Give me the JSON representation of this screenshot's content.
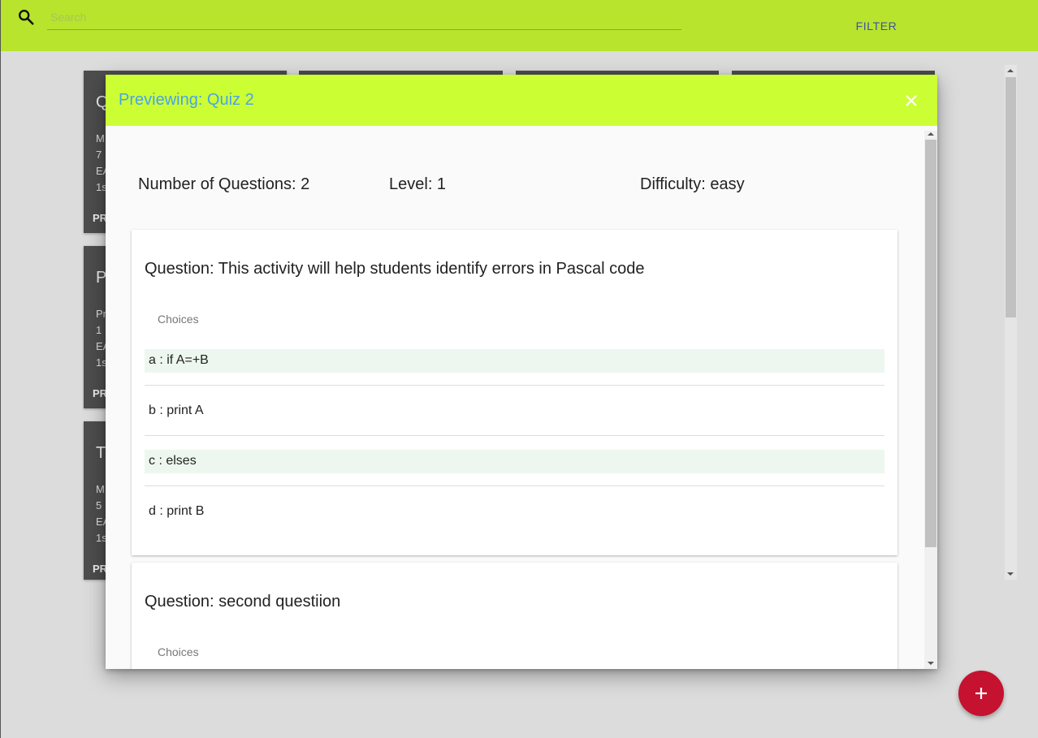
{
  "search": {
    "placeholder": "Search"
  },
  "toolbar": {
    "filter_label": "FILTER"
  },
  "background_cards": [
    {
      "title_initial": "Q",
      "lines": [
        "M",
        "7",
        "EA",
        "1s"
      ],
      "action": "PR"
    },
    {
      "title_initial": "P",
      "lines": [
        "Pr",
        "1",
        "EA",
        "1s"
      ],
      "action": "PR"
    },
    {
      "title_initial": "T",
      "lines": [
        "M",
        "5",
        "EA",
        "1s"
      ],
      "action": "PR"
    }
  ],
  "dialog": {
    "title": "Previewing: Quiz 2",
    "stats": {
      "questions": "Number of Questions: 2",
      "level": "Level: 1",
      "difficulty": "Difficulty: easy"
    },
    "questions": [
      {
        "title": "Question: This activity will help students identify errors in Pascal code",
        "choices_label": "Choices",
        "choices": [
          {
            "text": "a : if A=+B",
            "highlighted": true
          },
          {
            "text": "b : print A",
            "highlighted": false
          },
          {
            "text": "c : elses",
            "highlighted": true
          },
          {
            "text": "d : print B",
            "highlighted": false
          }
        ]
      },
      {
        "title": "Question: second questiion",
        "choices_label": "Choices"
      }
    ]
  },
  "colors": {
    "topbar": "#b8e42e",
    "dialog_header": "#ccff33",
    "dialog_title": "#4aa3e8",
    "filter_text": "#3f51a5",
    "fab": "#c41230",
    "choice_highlight": "#edf7ef"
  },
  "icons": {
    "search": "search-icon",
    "close": "close-icon",
    "add": "add-icon"
  }
}
